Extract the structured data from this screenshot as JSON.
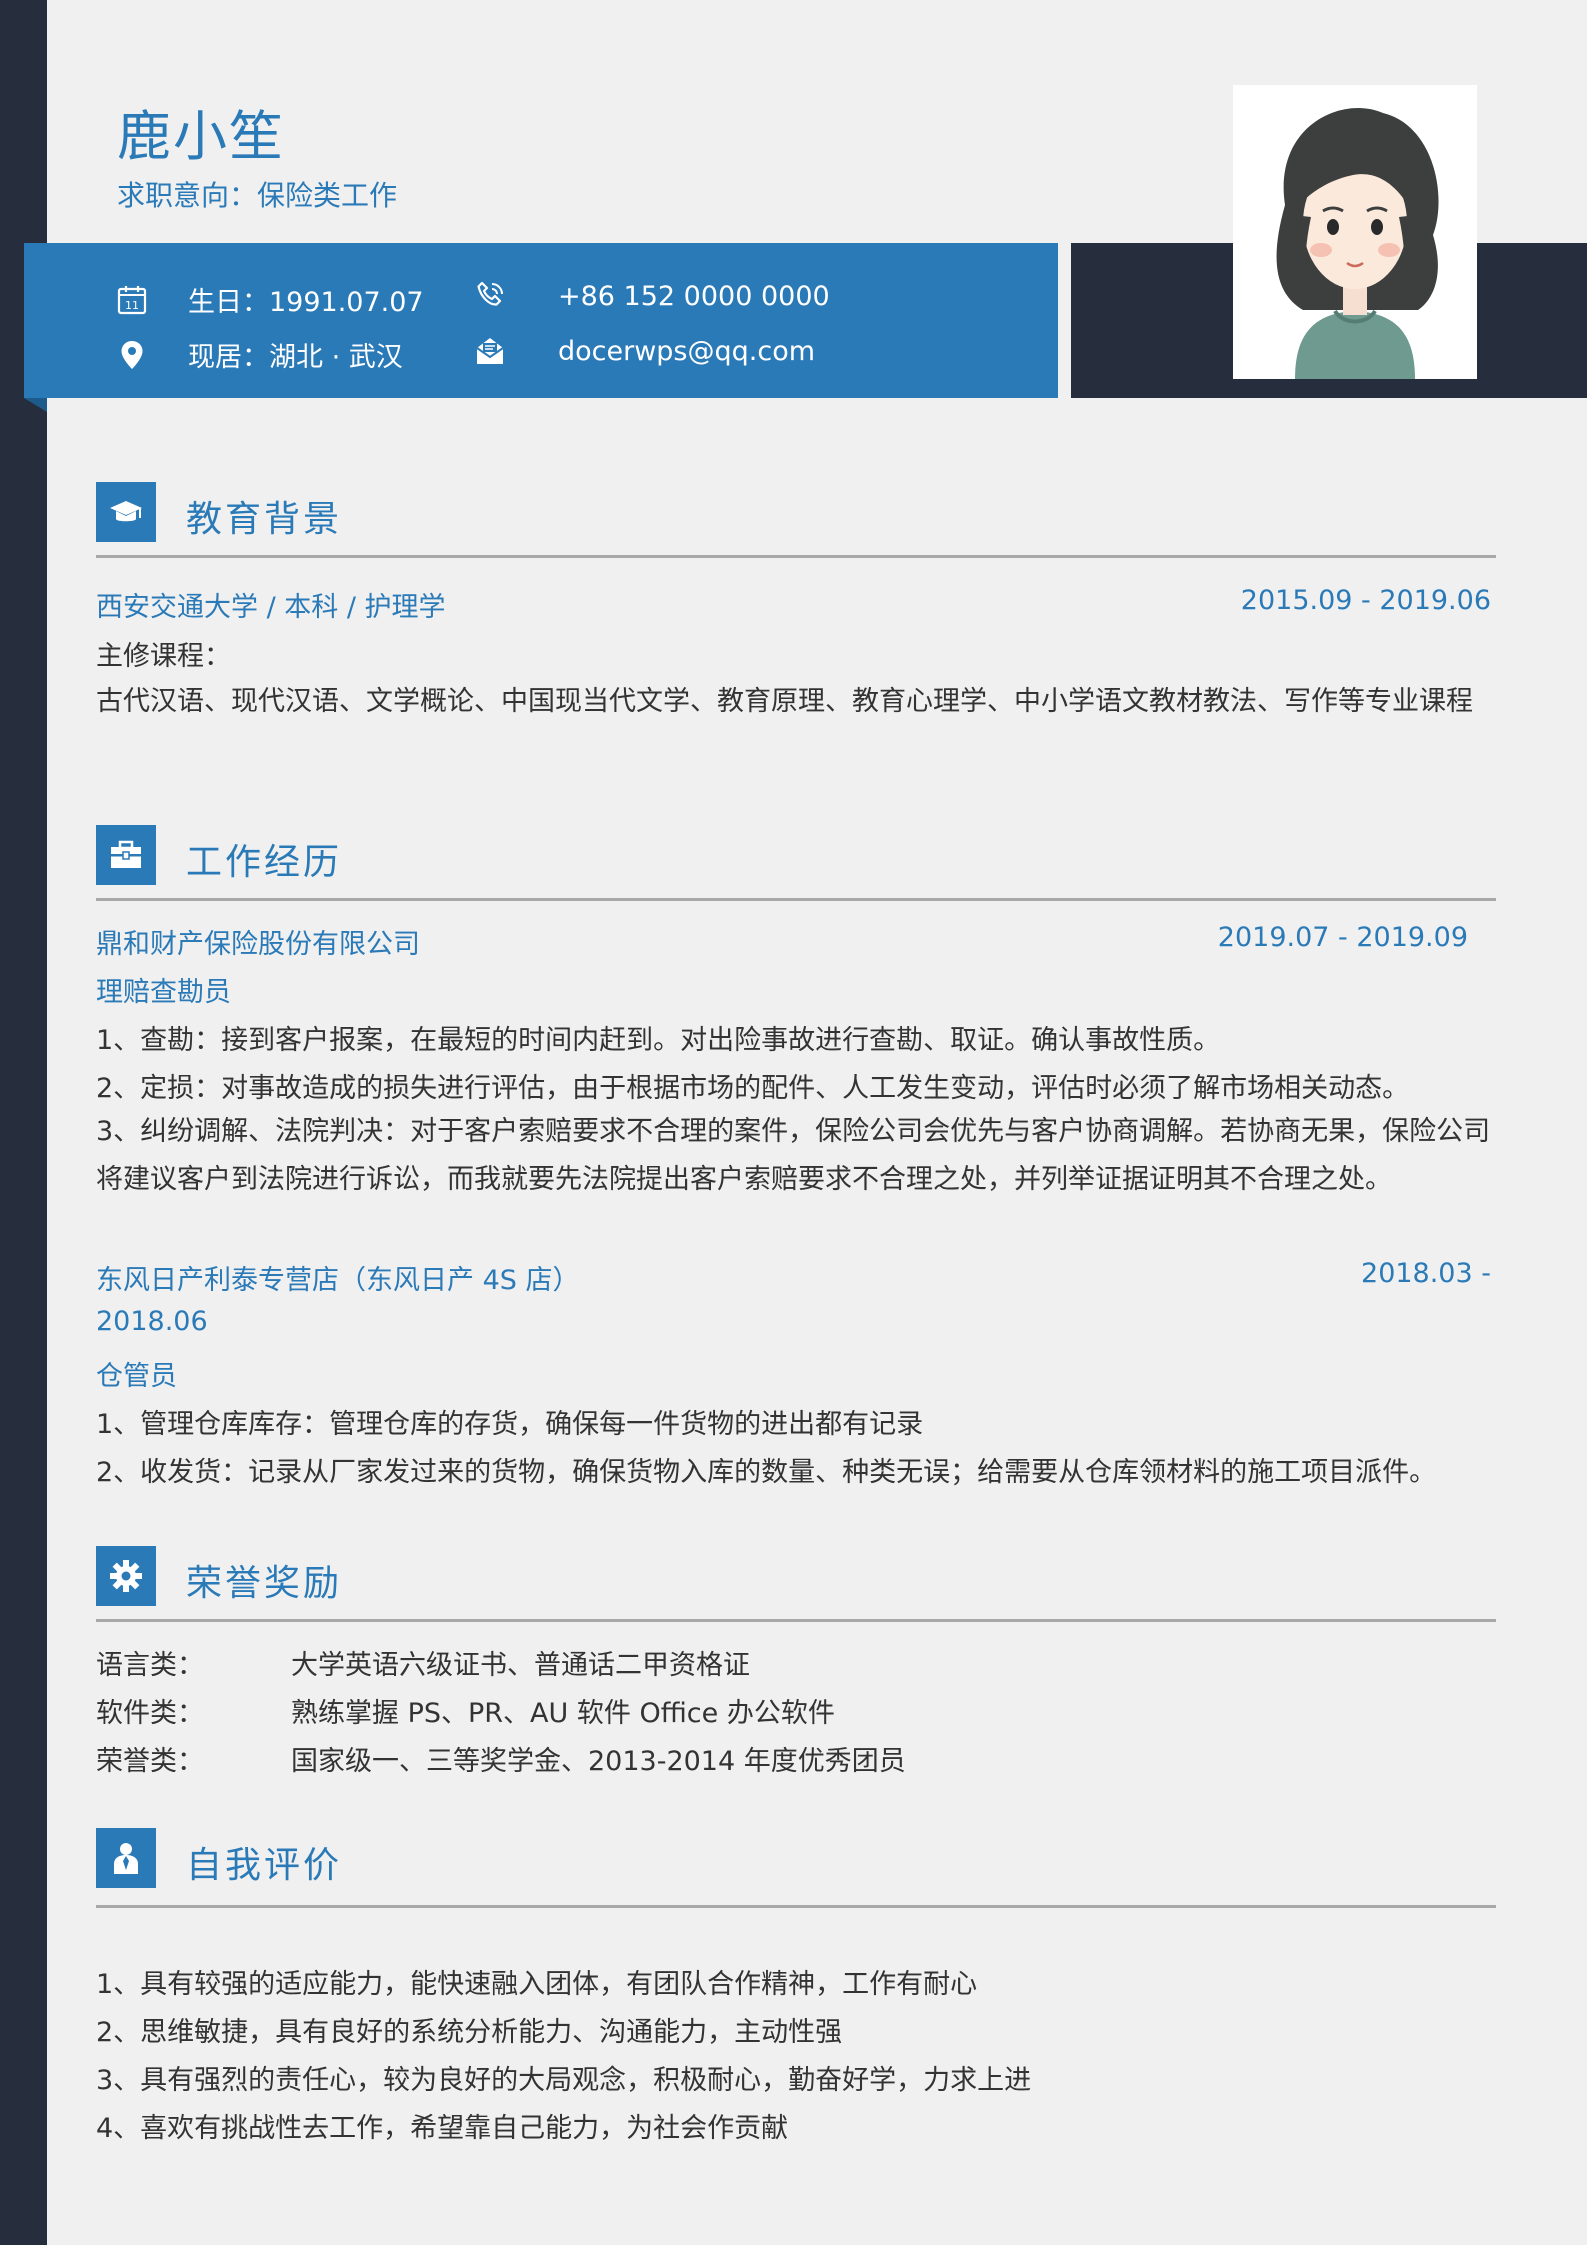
{
  "header": {
    "name": "鹿小笙",
    "objective": "求职意向：保险类工作"
  },
  "contact": {
    "birthday": "生日：1991.07.07",
    "location": "现居：湖北 · 武汉",
    "phone": "+86 152 0000 0000",
    "email": "docerwps@qq.com",
    "calendar_icon_day": "11"
  },
  "colors": {
    "accent": "#2b7ab8",
    "dark": "#262e3d",
    "background": "#f0f0f0"
  },
  "education": {
    "title": "教育背景",
    "school_line": "西安交通大学 / 本科 / 护理学",
    "period": "2015.09 - 2019.06",
    "courses_label": "主修课程：",
    "courses": "古代汉语、现代汉语、文学概论、中国现当代文学、教育原理、教育心理学、中小学语文教材教法、写作等专业课程"
  },
  "work": {
    "title": "工作经历",
    "jobs": [
      {
        "company": "鼎和财产保险股份有限公司",
        "period": "2019.07 - 2019.09",
        "role": "理赔查勘员",
        "duties": [
          "1、查勘：接到客户报案，在最短的时间内赶到。对出险事故进行查勘、取证。确认事故性质。",
          "2、定损：对事故造成的损失进行评估，由于根据市场的配件、人工发生变动，评估时必须了解市场相关动态。",
          "3、纠纷调解、法院判决：对于客户索赔要求不合理的案件，保险公司会优先与客户协商调解。若协商无果，保险公司将建议客户到法院进行诉讼，而我就要先法院提出客户索赔要求不合理之处，并列举证据证明其不合理之处。"
        ]
      },
      {
        "company": "东风日产利泰专营店（东风日产 4S 店）",
        "period_start": "2018.03 -",
        "period_end": "2018.06",
        "role": "仓管员",
        "duties": [
          "1、管理仓库库存：管理仓库的存货，确保每一件货物的进出都有记录",
          "2、收发货：记录从厂家发过来的货物，确保货物入库的数量、种类无误；给需要从仓库领材料的施工项目派件。"
        ]
      }
    ]
  },
  "honors": {
    "title": "荣誉奖励",
    "items": [
      {
        "label": "语言类：",
        "value": "大学英语六级证书、普通话二甲资格证"
      },
      {
        "label": "软件类：",
        "value": "熟练掌握 PS、PR、AU 软件 Office 办公软件"
      },
      {
        "label": "荣誉类：",
        "value": "国家级一、三等奖学金、2013-2014 年度优秀团员"
      }
    ]
  },
  "self_eval": {
    "title": "自我评价",
    "items": [
      "1、具有较强的适应能力，能快速融入团体，有团队合作精神，工作有耐心",
      "2、思维敏捷，具有良好的系统分析能力、沟通能力，主动性强",
      "3、具有强烈的责任心，较为良好的大局观念，积极耐心，勤奋好学，力求上进",
      "4、喜欢有挑战性去工作，希望靠自己能力，为社会作贡献"
    ]
  },
  "icons": {
    "education": "graduation-cap-icon",
    "work": "briefcase-icon",
    "honors": "gear-icon",
    "self_eval": "person-icon",
    "birthday": "calendar-icon",
    "location": "location-pin-icon",
    "phone": "phone-icon",
    "email": "email-icon"
  }
}
